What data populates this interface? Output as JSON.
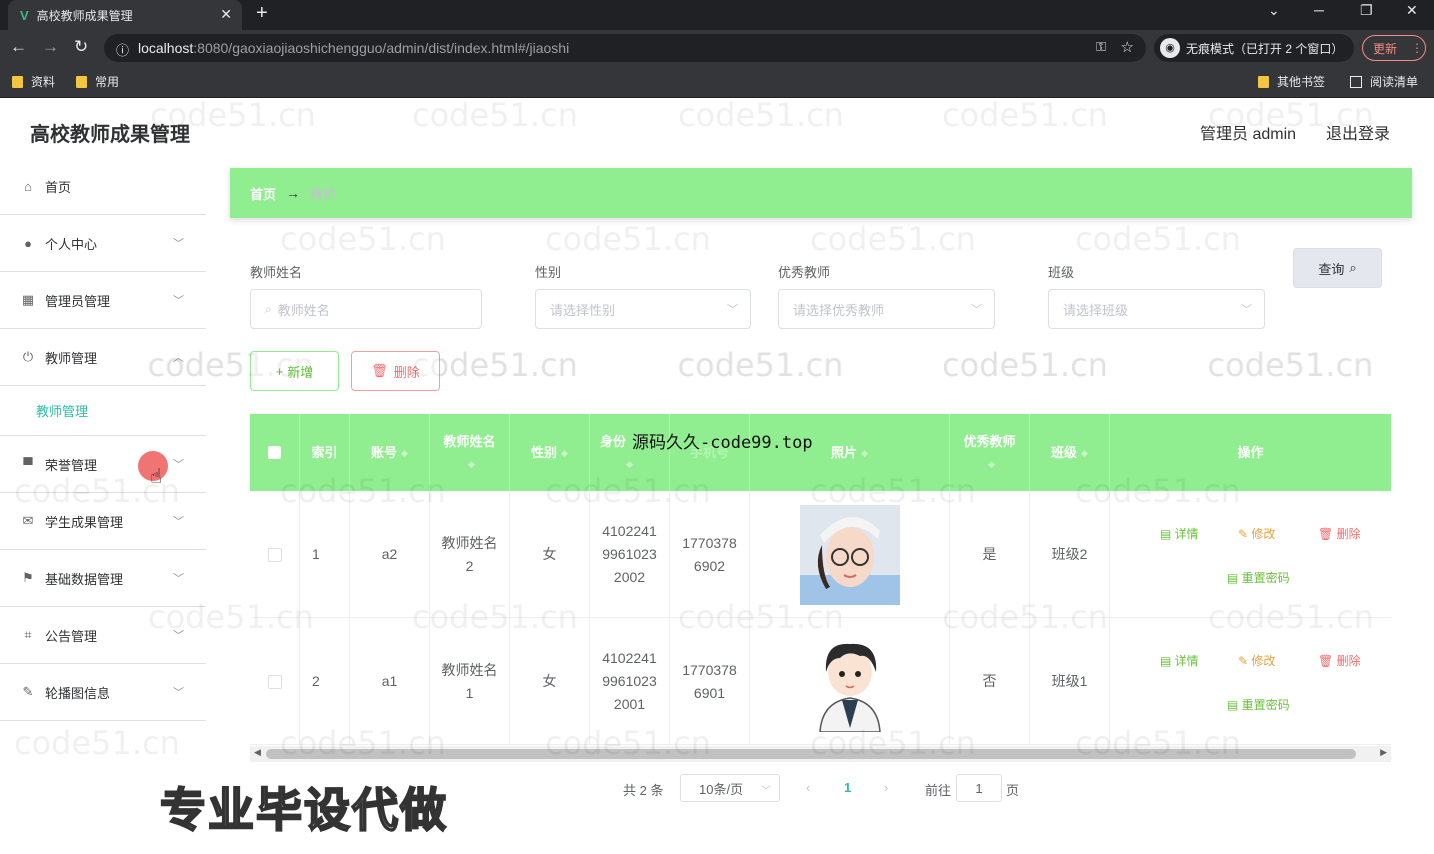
{
  "browser": {
    "tab_title": "高校教师成果管理",
    "tab_logo": "V",
    "url_host": "localhost",
    "url_path": ":8080/gaoxiaojiaoshichengguo/admin/dist/index.html#/jiaoshi",
    "incognito_label": "无痕模式（已打开 2 个窗口）",
    "update_label": "更新",
    "bookmarks": [
      "资料",
      "常用"
    ],
    "bookmarks_right": [
      "其他书签",
      "阅读清单"
    ]
  },
  "header": {
    "title": "高校教师成果管理",
    "user": "管理员 admin",
    "logout": "退出登录"
  },
  "sidebar": {
    "items": [
      {
        "label": "首页",
        "icon": "home-icon"
      },
      {
        "label": "个人中心",
        "icon": "user-icon"
      },
      {
        "label": "管理员管理",
        "icon": "grid-icon"
      },
      {
        "label": "教师管理",
        "icon": "power-icon"
      },
      {
        "label": "荣誉管理",
        "icon": "monitor-icon"
      },
      {
        "label": "学生成果管理",
        "icon": "mail-icon"
      },
      {
        "label": "基础数据管理",
        "icon": "flag-icon"
      },
      {
        "label": "公告管理",
        "icon": "crop-icon"
      },
      {
        "label": "轮播图信息",
        "icon": "edit-off-icon"
      }
    ],
    "sub_item": "教师管理"
  },
  "breadcrumb": {
    "home": "首页",
    "sep": "→",
    "current": "教师"
  },
  "filters": {
    "name_label": "教师姓名",
    "name_placeholder": "教师姓名",
    "gender_label": "性别",
    "gender_placeholder": "请选择性别",
    "excellent_label": "优秀教师",
    "excellent_placeholder": "请选择优秀教师",
    "class_label": "班级",
    "class_placeholder": "请选择班级",
    "query": "查询"
  },
  "actions": {
    "add": "新增",
    "delete": "删除"
  },
  "table": {
    "headers": [
      "索引",
      "账号",
      "教师姓名",
      "性别",
      "身份",
      "手机号",
      "照片",
      "优秀教师",
      "班级",
      "操作"
    ],
    "rows": [
      {
        "index": "1",
        "account": "a2",
        "name": "教师姓名 2",
        "gender": "女",
        "id_card": "410224199610232002",
        "phone": "17703786902",
        "excellent": "是",
        "class": "班级2"
      },
      {
        "index": "2",
        "account": "a1",
        "name": "教师姓名 1",
        "gender": "女",
        "id_card": "410224199610232001",
        "phone": "17703786901",
        "excellent": "否",
        "class": "班级1"
      }
    ],
    "op_detail": "详情",
    "op_edit": "修改",
    "op_delete": "删除",
    "op_reset": "重置密码"
  },
  "pagination": {
    "total": "共 2 条",
    "page_size": "10条/页",
    "current": "1",
    "goto_label": "前往",
    "goto_value": "1",
    "page_unit": "页"
  },
  "watermarks": {
    "site": "code51.cn",
    "overlay_source": "源码久久-code99.top",
    "overlay_ad": "专业毕设代做"
  },
  "colors": {
    "accent_green": "#90ee90",
    "active_teal": "#2bbfa5"
  }
}
